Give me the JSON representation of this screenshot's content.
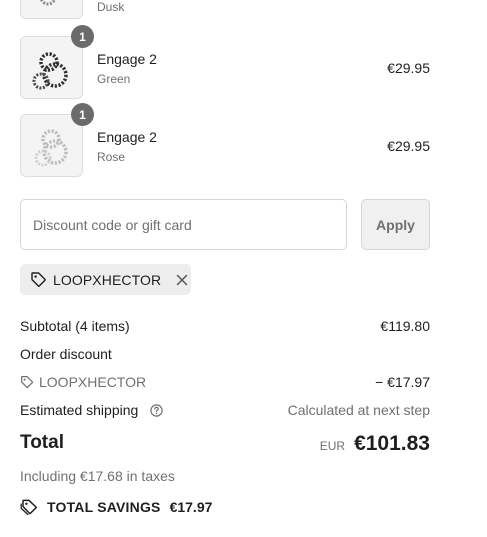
{
  "items": [
    {
      "name": "",
      "variant": "Dusk",
      "price": "",
      "qty": "",
      "icon": "earring-thumbnail-icon",
      "tone": "#8a8a8a"
    },
    {
      "name": "Engage 2",
      "variant": "Green",
      "price": "€29.95",
      "qty": "1",
      "icon": "earring-thumbnail-icon",
      "tone": "#2f2f2f"
    },
    {
      "name": "Engage 2",
      "variant": "Rose",
      "price": "€29.95",
      "qty": "1",
      "icon": "earring-thumbnail-icon",
      "tone": "#bdbdbd"
    }
  ],
  "discount": {
    "placeholder": "Discount code or gift card",
    "apply_label": "Apply",
    "applied_code": "LOOPXHECTOR"
  },
  "summary": {
    "subtotal_label": "Subtotal (4 items)",
    "subtotal_value": "€119.80",
    "order_discount_label": "Order discount",
    "discount_code": "LOOPXHECTOR",
    "discount_value": "− €17.97",
    "shipping_label": "Estimated shipping",
    "shipping_value": "Calculated at next step",
    "total_label": "Total",
    "currency": "EUR",
    "total_value": "€101.83",
    "taxes_text": "Including €17.68 in taxes",
    "savings_label": "TOTAL SAVINGS",
    "savings_value": "€17.97"
  }
}
